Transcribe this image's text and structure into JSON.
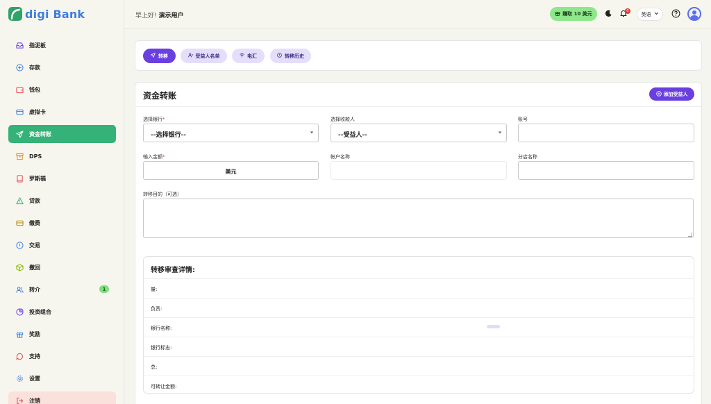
{
  "brand": {
    "name": "digi Bank",
    "logo_color": "#2fa36a",
    "text_color": "#3d7ee0"
  },
  "sidebar": {
    "items": [
      {
        "label": "指泥板",
        "icon": "inbox-icon",
        "color": "#6a3fe0"
      },
      {
        "label": "存款",
        "icon": "plus-circle-icon",
        "color": "#3d7ee0"
      },
      {
        "label": "钱包",
        "icon": "wallet-icon",
        "color": "#e5484d"
      },
      {
        "label": "虚拟卡",
        "icon": "card-icon",
        "color": "#3d7ee0"
      },
      {
        "label": "资金转账",
        "icon": "send-icon",
        "color": "#ffffff",
        "active": true
      },
      {
        "label": "DPS",
        "icon": "archive-icon",
        "color": "#e08a1e"
      },
      {
        "label": "罗斯福",
        "icon": "book-icon",
        "color": "#e5484d"
      },
      {
        "label": "贷款",
        "icon": "warning-icon",
        "color": "#35b277"
      },
      {
        "label": "缴费",
        "icon": "bill-icon",
        "color": "#b58a00"
      },
      {
        "label": "交易",
        "icon": "info-icon",
        "color": "#3d7ee0"
      },
      {
        "label": "撤回",
        "icon": "box-icon",
        "color": "#8bb800"
      },
      {
        "label": "转介",
        "icon": "users-icon",
        "color": "#3d7ee0",
        "badge": "1"
      },
      {
        "label": "投资组合",
        "icon": "pie-icon",
        "color": "#6a3fe0"
      },
      {
        "label": "奖励",
        "icon": "gift-icon",
        "color": "#3d7ee0"
      },
      {
        "label": "支持",
        "icon": "chat-icon",
        "color": "#e5484d"
      },
      {
        "label": "设置",
        "icon": "gear-icon",
        "color": "#3d7ee0"
      },
      {
        "label": "注销",
        "icon": "logout-icon",
        "color": "#e5484d",
        "logout": true
      }
    ]
  },
  "header": {
    "greeting": "早上好!",
    "user": "演示用户",
    "promo": "赚取 10 美元",
    "notif_count": "0",
    "language": "英语"
  },
  "tabs": [
    {
      "label": "转移",
      "icon": "send-icon",
      "active": true
    },
    {
      "label": "受益人名单",
      "icon": "user-list-icon"
    },
    {
      "label": "电汇",
      "icon": "wifi-icon"
    },
    {
      "label": "转移历史",
      "icon": "history-icon"
    }
  ],
  "form": {
    "title": "资金转账",
    "add_beneficiary": "添加受益人",
    "bank_label": "选择银行",
    "bank_value": "--选择银行--",
    "payee_label": "选择收款人",
    "payee_value": "--受益人--",
    "account_no_label": "账号",
    "amount_label": "输入金额",
    "amount_unit": "美元",
    "account_name_label": "帐户名称",
    "branch_label": "分店名称",
    "purpose_label": "转移目的（可选）",
    "required_mark": "*"
  },
  "review": {
    "title": "转移审查详情:",
    "rows": [
      "量:",
      "负责:",
      "银行名称:",
      "银行标志:",
      "总:",
      "可转让金额:"
    ]
  },
  "colors": {
    "primary": "#6a3fe0",
    "green": "#35b277",
    "promo": "#8ee78a"
  }
}
